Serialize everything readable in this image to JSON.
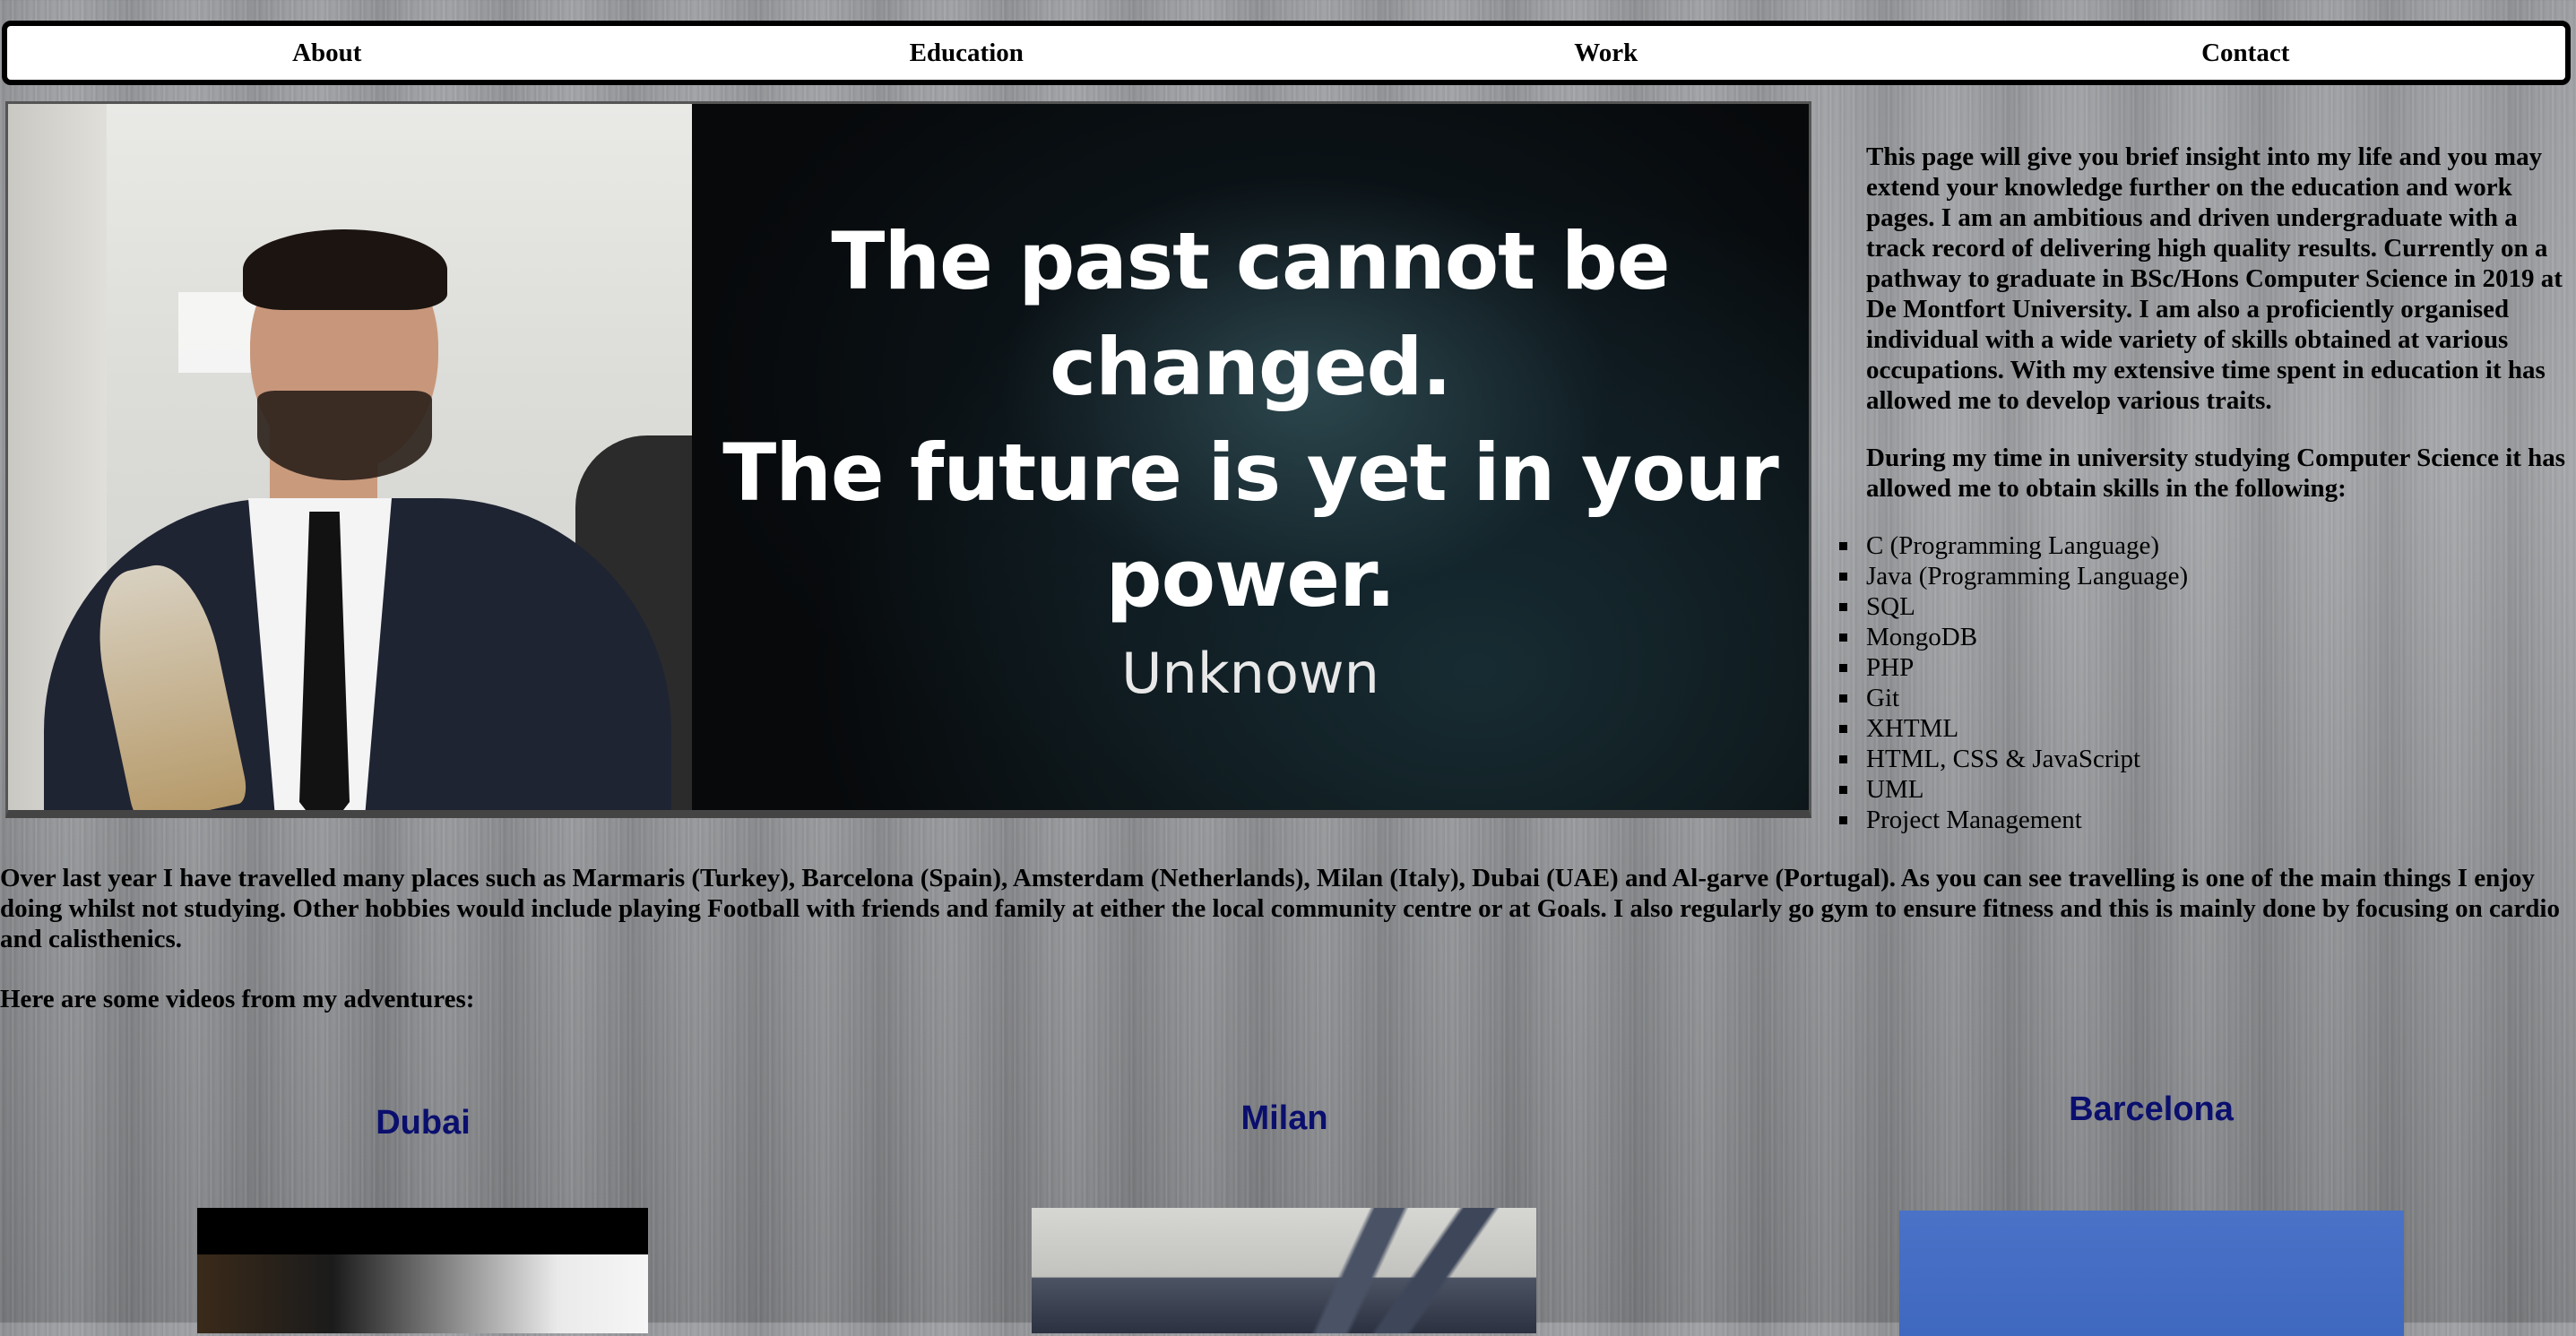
{
  "nav": {
    "items": [
      "About",
      "Education",
      "Work",
      "Contact"
    ]
  },
  "hero": {
    "quote_lines": [
      "The past cannot be changed.",
      "The future is yet in your",
      "power."
    ],
    "quote_author": "Unknown"
  },
  "bio": {
    "paragraph1": "This page will give you brief insight into my life and you may extend your knowledge further on the education and work pages. I am an ambitious and driven undergraduate with a track record of delivering high quality results. Currently on a pathway to graduate in BSc/Hons Computer Science in 2019 at De Montfort University. I am also a proficiently organised individual with a wide variety of skills obtained at various occupations. With my extensive time spent in education it has allowed me to develop various traits.",
    "paragraph2": "During my time in university studying Computer Science it has allowed me to obtain skills in the following:"
  },
  "skills": [
    "C (Programming Language)",
    "Java (Programming Language)",
    "SQL",
    "MongoDB",
    "PHP",
    "Git",
    "XHTML",
    "HTML, CSS & JavaScript",
    "UML",
    "Project Management"
  ],
  "travel": {
    "paragraph": "Over last year I have travelled many places such as Marmaris (Turkey), Barcelona (Spain), Amsterdam (Netherlands), Milan (Italy), Dubai (UAE) and Al-garve (Portugal). As you can see travelling is one of the main things I enjoy doing whilst not studying. Other hobbies would include playing Football with friends and family at either the local community centre or at Goals. I also regularly go gym to ensure fitness and this is mainly done by focusing on cardio and calisthenics.",
    "videos_intro": "Here are some videos from my adventures:"
  },
  "videos": [
    {
      "title": "Dubai"
    },
    {
      "title": "Milan"
    },
    {
      "title": "Barcelona"
    }
  ],
  "colors": {
    "video_title": "#0a0f6e",
    "nav_border": "#000000",
    "nav_background": "#ffffff"
  }
}
